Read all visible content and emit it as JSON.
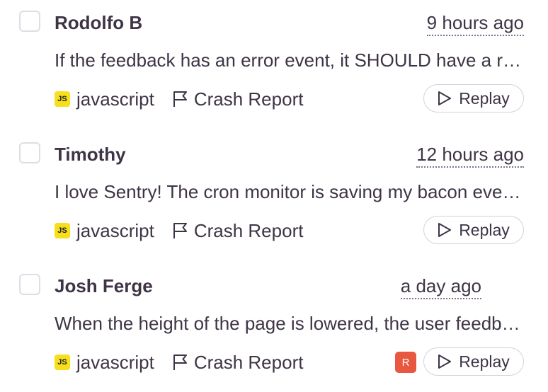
{
  "feedback_items": [
    {
      "name": "Rodolfo B",
      "time": "9 hours ago",
      "message": "If the feedback has an error event, it SHOULD have a replay attached",
      "platform": "javascript",
      "platform_badge": "JS",
      "category": "Crash Report",
      "replay_label": "Replay"
    },
    {
      "name": "Timothy",
      "time": "12 hours ago",
      "message": "I love Sentry! The cron monitor is saving my bacon every day",
      "platform": "javascript",
      "platform_badge": "JS",
      "category": "Crash Report",
      "replay_label": "Replay"
    },
    {
      "name": "Josh Ferge",
      "time": "a day ago",
      "message": "When the height of the page is lowered, the user feedback list gets cut off",
      "platform": "javascript",
      "platform_badge": "JS",
      "category": "Crash Report",
      "replay_label": "Replay",
      "assignee_initial": "R"
    }
  ],
  "colors": {
    "text": "#3e3446",
    "js_badge": "#f7df1e",
    "avatar": "#e8573f",
    "border": "#d6d0dc"
  },
  "icons": {
    "platform": "javascript-icon",
    "category": "flag-icon",
    "replay": "play-icon"
  }
}
